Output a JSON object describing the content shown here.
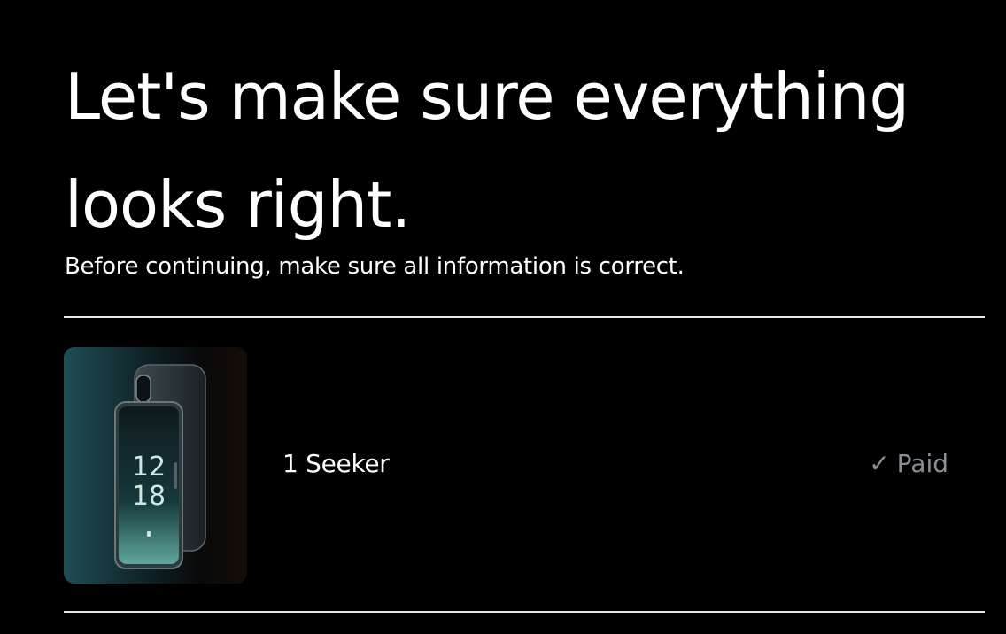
{
  "header": {
    "title": "Let's make sure everything looks right.",
    "subtitle": "Before continuing, make sure all information is correct."
  },
  "order_item": {
    "quantity_label": "1 Seeker",
    "image_alt": "Seeker phone",
    "status_icon": "check-icon",
    "status_label": "Paid",
    "phone_screen_time_hours": "12",
    "phone_screen_time_minutes": "18"
  },
  "colors": {
    "background": "#000000",
    "text": "#ffffff",
    "status": "#8b8f96",
    "divider": "#e6e6e6"
  }
}
